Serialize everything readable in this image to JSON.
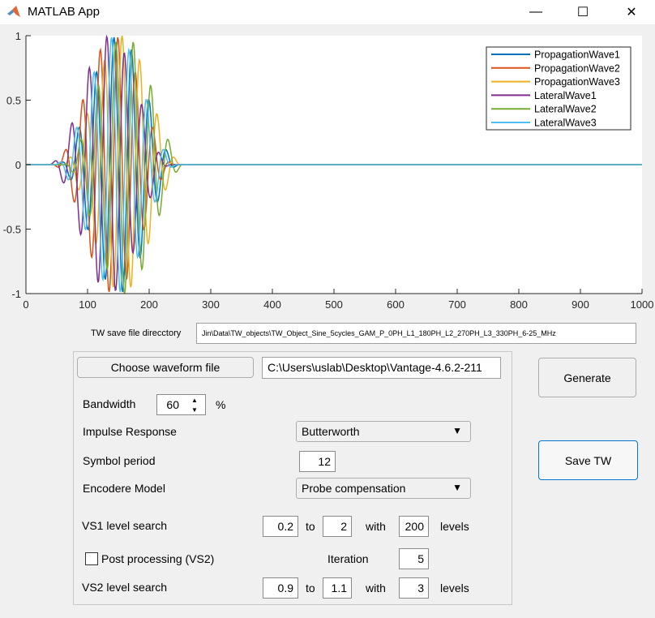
{
  "window": {
    "title": "MATLAB App",
    "minimize_glyph": "—",
    "maximize_glyph": "☐",
    "close_glyph": "✕"
  },
  "plot": {
    "legend": [
      "PropagationWave1",
      "PropagationWave2",
      "PropagationWave3",
      "LateralWave1",
      "LateralWave2",
      "LateralWave3"
    ],
    "colors": [
      "#0072bd",
      "#d95319",
      "#edb120",
      "#7e2f8e",
      "#77ac30",
      "#4dbeee"
    ],
    "xticks": [
      "0",
      "100",
      "200",
      "300",
      "400",
      "500",
      "600",
      "700",
      "800",
      "900",
      "1000"
    ],
    "yticks": [
      "1",
      "0.5",
      "0",
      "-0.5",
      "-1"
    ]
  },
  "chart_data": {
    "type": "line",
    "xlim": [
      0,
      1000
    ],
    "ylim": [
      -1,
      1
    ],
    "series": [
      {
        "name": "PropagationWave1",
        "values": "0 outside 50–250; sine burst 5 cycles, peak ~1 near x=150"
      },
      {
        "name": "PropagationWave2",
        "values": "phase-shifted sine burst"
      },
      {
        "name": "PropagationWave3",
        "values": "phase-shifted sine burst"
      },
      {
        "name": "LateralWave1",
        "values": "phase-shifted sine burst"
      },
      {
        "name": "LateralWave2",
        "values": "phase-shifted sine burst"
      },
      {
        "name": "LateralWave3",
        "values": "phase-shifted sine burst"
      }
    ],
    "grid": false,
    "legend_position": "top-right"
  },
  "save_dir": {
    "label": "TW save file direcctory",
    "value": "Jin\\Data\\TW_objects\\TW_Object_Sine_5cycles_GAM_P_0PH_L1_180PH_L2_270PH_L3_330PH_6-25_MHz"
  },
  "panel": {
    "choose_button": "Choose waveform file",
    "file_path": "C:\\Users\\uslab\\Desktop\\Vantage-4.6.2-211",
    "bandwidth_label": "Bandwidth",
    "bandwidth_value": "60",
    "bandwidth_unit": "%",
    "impulse_label": "Impulse Response",
    "impulse_value": "Butterworth",
    "symbol_label": "Symbol period",
    "symbol_value": "12",
    "encoder_label": "Encodere Model",
    "encoder_value": "Probe compensation",
    "vs1_label": "VS1 level  search",
    "vs1_from": "0.2",
    "vs1_to_label": "to",
    "vs1_to": "2",
    "vs1_with_label": "with",
    "vs1_levels": "200",
    "vs1_levels_label": "levels",
    "post_label": "Post processing (VS2)",
    "iteration_label": "Iteration",
    "iteration_value": "5",
    "vs2_label": "VS2 level  search",
    "vs2_from": "0.9",
    "vs2_to_label": "to",
    "vs2_to": "1.1",
    "vs2_with_label": "with",
    "vs2_levels": "3",
    "vs2_levels_label": "levels"
  },
  "buttons": {
    "generate": "Generate",
    "save_tw": "Save TW"
  }
}
